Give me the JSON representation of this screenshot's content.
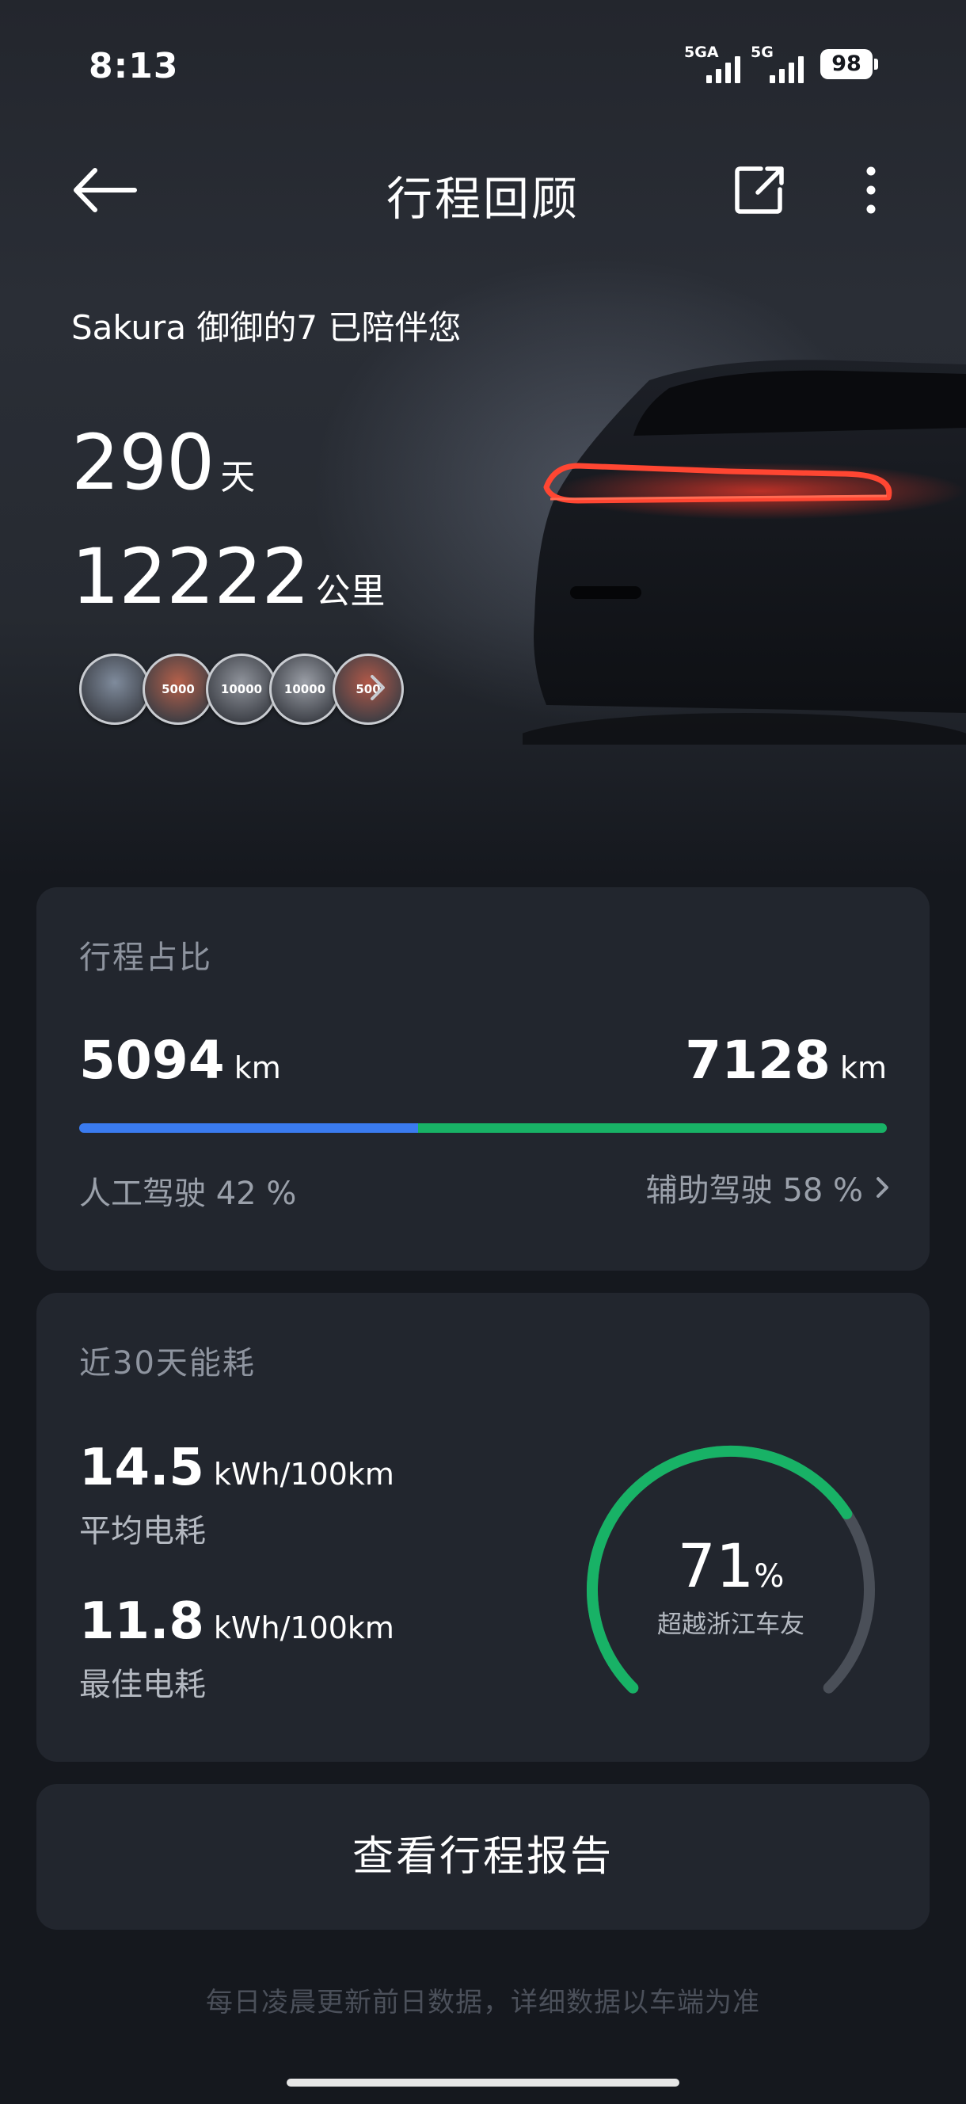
{
  "status": {
    "time": "8:13",
    "signal1": "5GA",
    "signal2": "5G",
    "battery": "98"
  },
  "header": {
    "title": "行程回顾"
  },
  "summary": {
    "car_line": "Sakura 御御的7 已陪伴您",
    "days_value": "290",
    "days_unit": "天",
    "distance_value": "12222",
    "distance_unit": "公里",
    "badges": [
      {
        "text": "",
        "color": "#7f8b9c"
      },
      {
        "text": "5000",
        "color": "#b5604a"
      },
      {
        "text": "10000",
        "color": "#8f939b"
      },
      {
        "text": "10000",
        "color": "#9a9ea6"
      },
      {
        "text": "500",
        "color": "#b05848"
      }
    ]
  },
  "trip_ratio": {
    "title": "行程占比",
    "manual_value": "5094",
    "assist_value": "7128",
    "unit": "km",
    "manual_label": "人工驾驶 42 %",
    "assist_label": "辅助驾驶 58 %",
    "manual_fraction": 0.42,
    "colors": {
      "manual": "#3a7bf0",
      "assist": "#18b266"
    }
  },
  "energy": {
    "title": "近30天能耗",
    "avg_value": "14.5",
    "avg_unit": "kWh/100km",
    "avg_label": "平均电耗",
    "best_value": "11.8",
    "best_unit": "kWh/100km",
    "best_label": "最佳电耗",
    "gauge_value": "71",
    "gauge_unit": "%",
    "gauge_label": "超越浙江车友",
    "gauge_fraction": 0.71,
    "colors": {
      "active": "#18b266",
      "track": "#4a4f58"
    }
  },
  "report_button": "查看行程报告",
  "footer_note": "每日凌晨更新前日数据，详细数据以车端为准"
}
